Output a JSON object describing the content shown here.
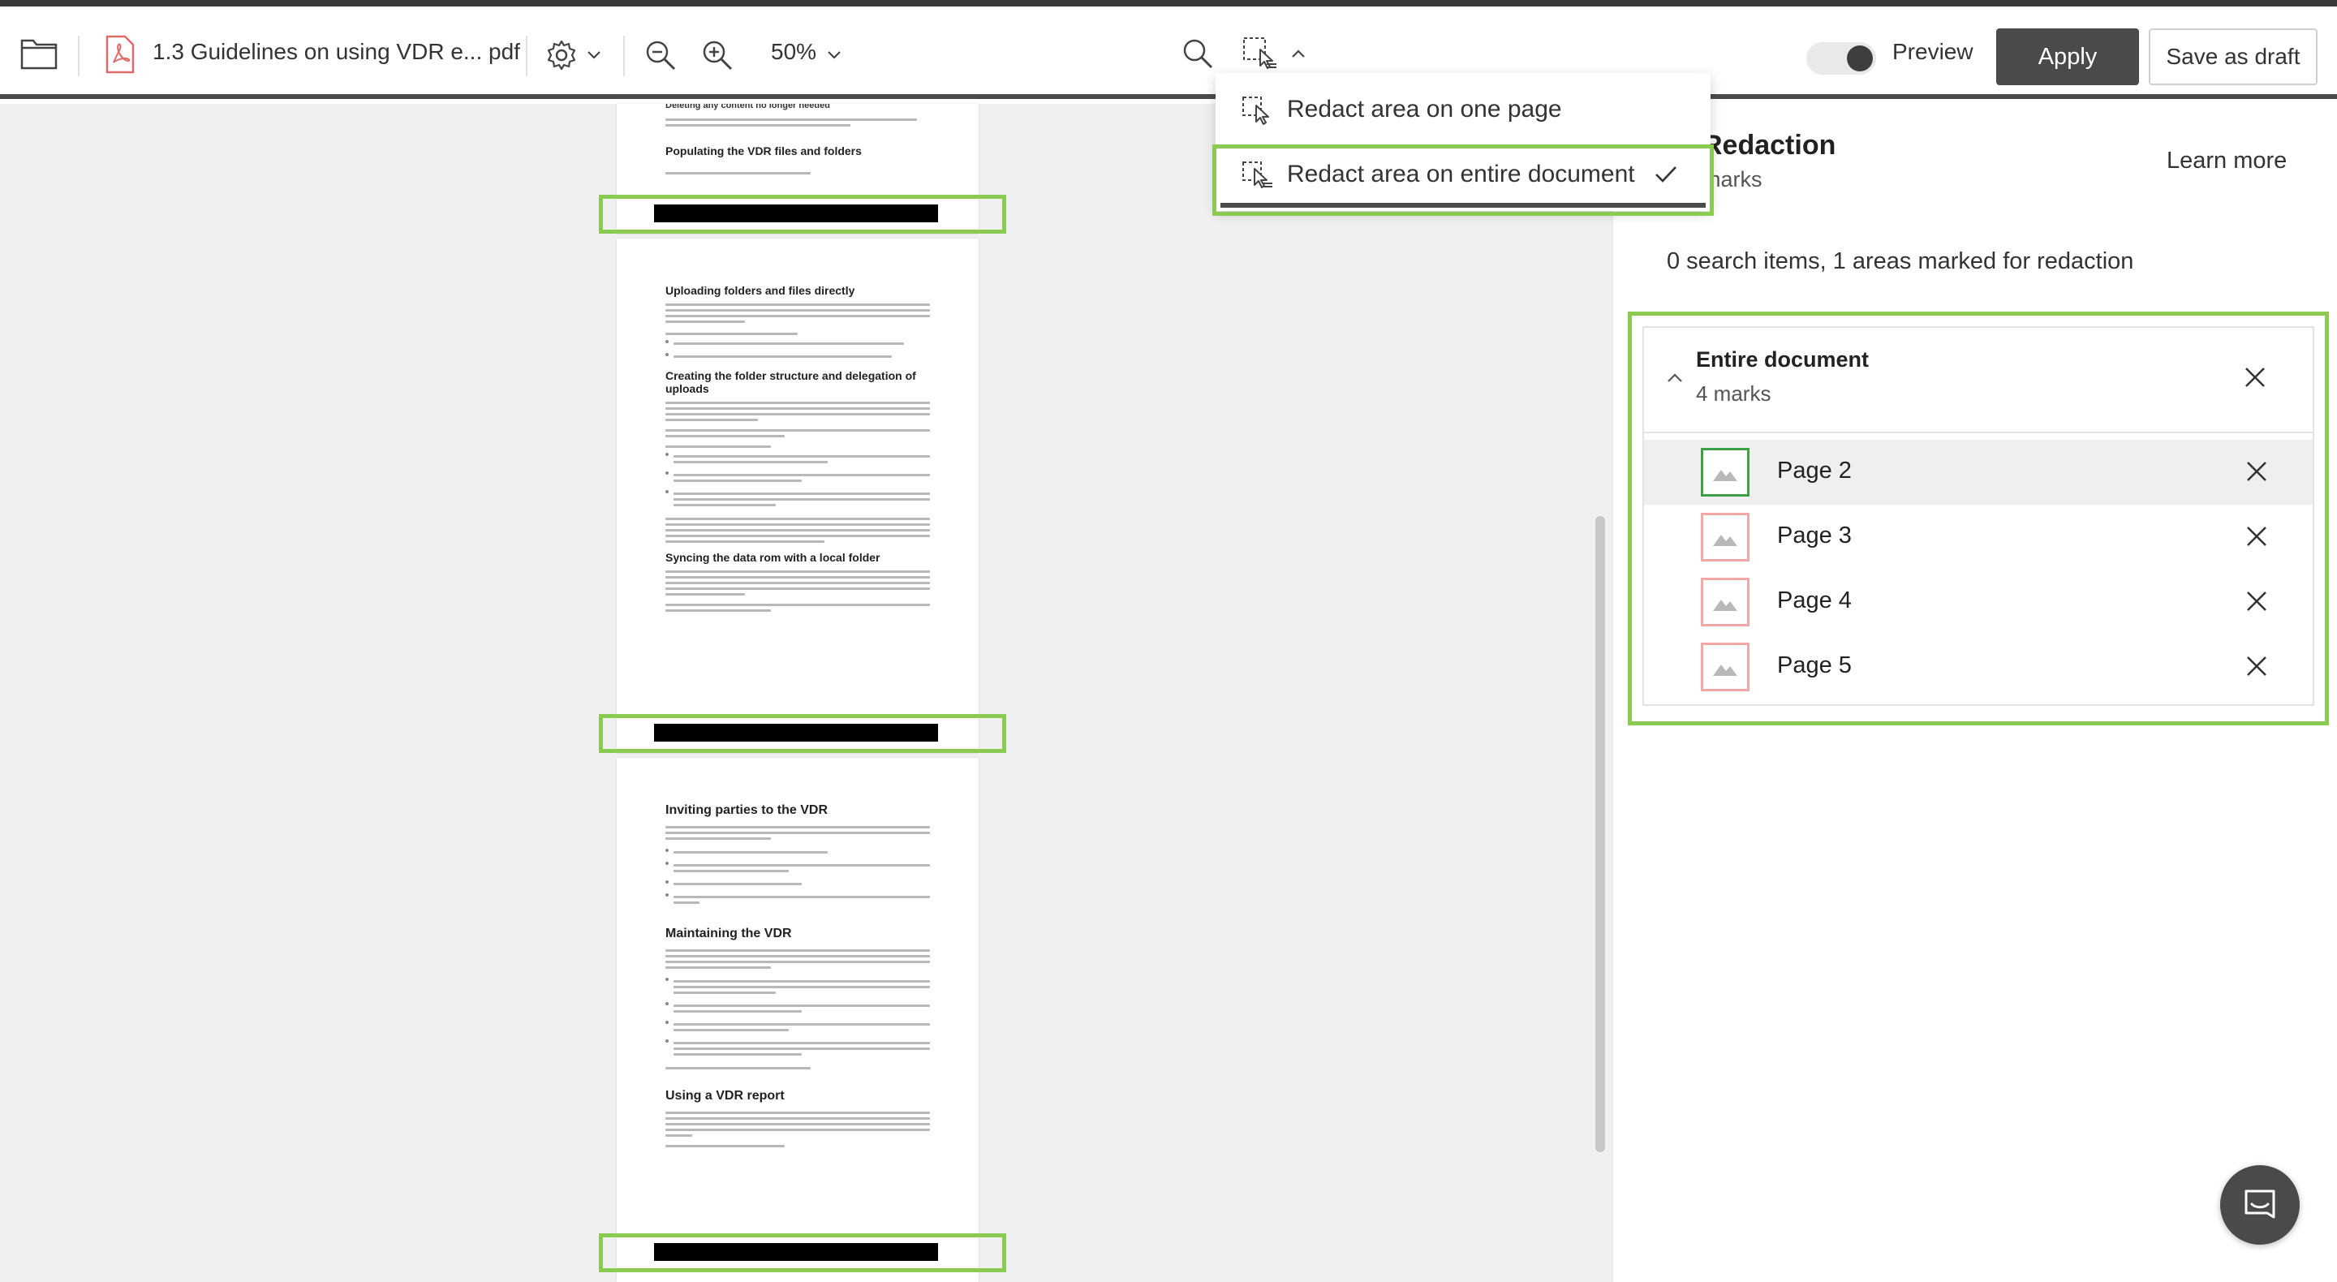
{
  "toolbar": {
    "file_name": "1.3 Guidelines on using VDR e... pdf",
    "zoom": "50%",
    "preview_label": "Preview",
    "preview_on": true,
    "apply_label": "Apply",
    "save_draft_label": "Save as draft"
  },
  "dropdown": {
    "items": [
      {
        "label": "Redact area on one page",
        "selected": false
      },
      {
        "label": "Redact area on entire document",
        "selected": true
      }
    ]
  },
  "panel": {
    "title": "Redaction",
    "subtitle": "marks",
    "learn_more": "Learn more",
    "summary": "0 search items, 1 areas marked for redaction",
    "group": {
      "title": "Entire document",
      "count": "4 marks",
      "pages": [
        {
          "label": "Page 2",
          "selected": true
        },
        {
          "label": "Page 3",
          "selected": false
        },
        {
          "label": "Page 4",
          "selected": false
        },
        {
          "label": "Page 5",
          "selected": false
        }
      ]
    }
  },
  "document": {
    "page1": {
      "top_heading": "Deleting any content no longer needed",
      "heading": "Populating the VDR files and folders"
    },
    "page2": {
      "headings": [
        "Uploading folders and files directly",
        "Creating the folder structure and delegation of uploads",
        "Syncing the data rom with a local folder"
      ]
    },
    "page3": {
      "headings": [
        "Inviting parties to the VDR",
        "Maintaining the VDR",
        "Using a VDR report"
      ]
    }
  },
  "colors": {
    "highlight_green": "#8bcb52",
    "selected_thumb": "#3ea046",
    "thumb_border": "#f0a8a8",
    "dark_button": "#4a4a4a"
  }
}
